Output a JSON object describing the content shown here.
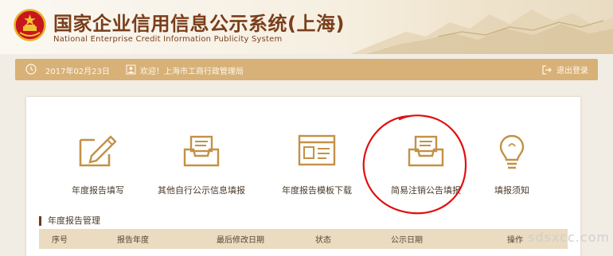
{
  "header": {
    "title": "国家企业信用信息公示系统(上海)",
    "subtitle": "National Enterprise Credit Information Publicity System"
  },
  "toolbar": {
    "date": "2017年02月23日",
    "welcome": "欢迎！上海市工商行政管理局",
    "logout_label": "退出登录"
  },
  "tiles": [
    {
      "label": "年度报告填写",
      "icon": "pencil-edit-icon"
    },
    {
      "label": "其他自行公示信息填报",
      "icon": "tray-document-icon"
    },
    {
      "label": "年度报告模板下载",
      "icon": "browser-window-icon"
    },
    {
      "label": "简易注销公告填报",
      "icon": "tray-document-icon"
    },
    {
      "label": "填报须知",
      "icon": "lightbulb-icon"
    }
  ],
  "section": {
    "title": "年度报告管理"
  },
  "table": {
    "columns": [
      "序号",
      "报告年度",
      "最后修改日期",
      "状态",
      "公示日期",
      "操作"
    ]
  },
  "watermark": "sdsxcc.com",
  "colors": {
    "brand_brown": "#7a3e1b",
    "toolbar_gold": "#d7b178",
    "icon_gold": "#c39146",
    "table_header": "#eadbc1",
    "annotation_red": "#e01010"
  }
}
